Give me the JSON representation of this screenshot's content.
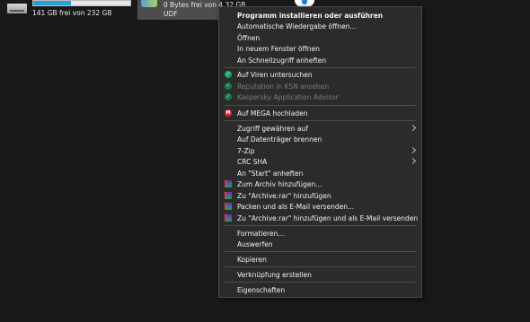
{
  "drives": {
    "left": {
      "free_text": "141 GB frei von 232 GB",
      "usage_fraction": 0.39
    },
    "selected": {
      "line1": "0 Bytes frei von 4,32 GB",
      "line2": "UDF"
    }
  },
  "colors": {
    "menu_background": "#2b2b2b",
    "usage_bar": "#26a0da",
    "shield_green": "#1fa463",
    "mega_red": "#d9272e"
  },
  "menu": {
    "items": {
      "install": "Programm installieren oder ausführen",
      "autoplay": "Automatische Wiedergabe öffnen...",
      "open": "Öffnen",
      "open_new_window": "In neuem Fenster öffnen",
      "pin_quick_access": "An Schnellzugriff anheften",
      "virus_scan": "Auf Viren untersuchen",
      "ksn_reputation": "Reputation in KSN ansehen",
      "kaspersky_advisor": "Kaspersky Application Advisor",
      "mega_upload": "Auf MEGA hochladen",
      "give_access": "Zugriff gewähren auf",
      "burn_disc": "Auf Datenträger brennen",
      "seven_zip": "7-Zip",
      "crc_sha": "CRC SHA",
      "pin_start": "An \"Start\" anheften",
      "add_archive": "Zum Archiv hinzufügen...",
      "add_archive_rar": "Zu \"Archive.rar\" hinzufügen",
      "pack_email": "Packen und als E-Mail versenden...",
      "add_rar_email": "Zu \"Archive.rar\" hinzufügen und als E-Mail versenden",
      "format": "Formatieren...",
      "eject": "Auswerfen",
      "copy": "Kopieren",
      "create_shortcut": "Verknüpfung erstellen",
      "properties": "Eigenschaften"
    },
    "icons": {
      "shield": "kaspersky-shield-icon",
      "mega": "mega-icon",
      "mega_glyph": "M",
      "rar": "winrar-icon",
      "check_glyph": "✓"
    }
  }
}
